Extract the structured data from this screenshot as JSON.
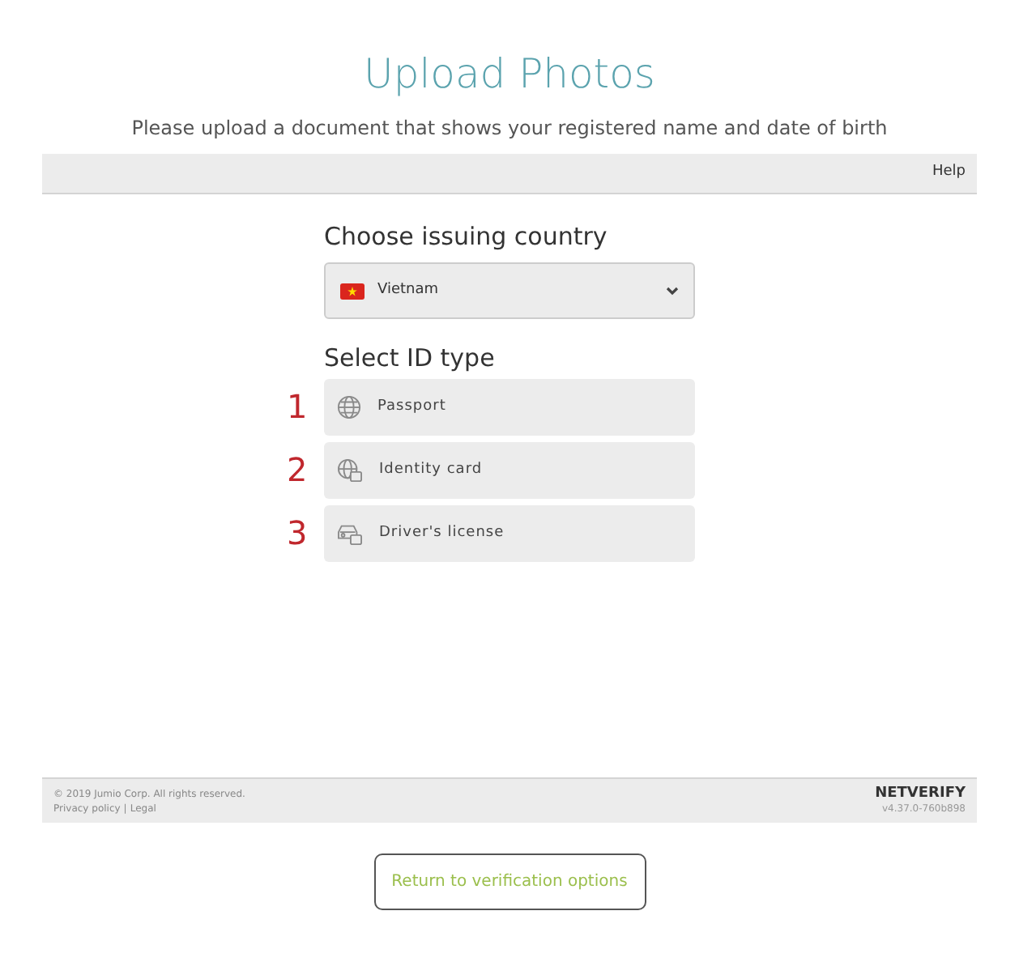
{
  "header": {
    "title": "Upload Photos",
    "subtitle": "Please upload a document that shows your registered name and date of birth"
  },
  "toolbar": {
    "help": "Help"
  },
  "country": {
    "heading": "Choose issuing country",
    "value": "Vietnam"
  },
  "id_type": {
    "heading": "Select ID type",
    "options": [
      {
        "number": "1",
        "label": "Passport",
        "kind": "passport"
      },
      {
        "number": "2",
        "label": "Identity card",
        "kind": "identity"
      },
      {
        "number": "3",
        "label": "Driver's license",
        "kind": "driver"
      }
    ]
  },
  "footer": {
    "copyright": "© 2019 Jumio Corp. All rights reserved.",
    "links": [
      "Privacy policy",
      "Legal"
    ],
    "link_separator": "|",
    "brand": "NETVERIFY",
    "version": "v4.37.0-760b898"
  },
  "return_button": "Return to verification options"
}
